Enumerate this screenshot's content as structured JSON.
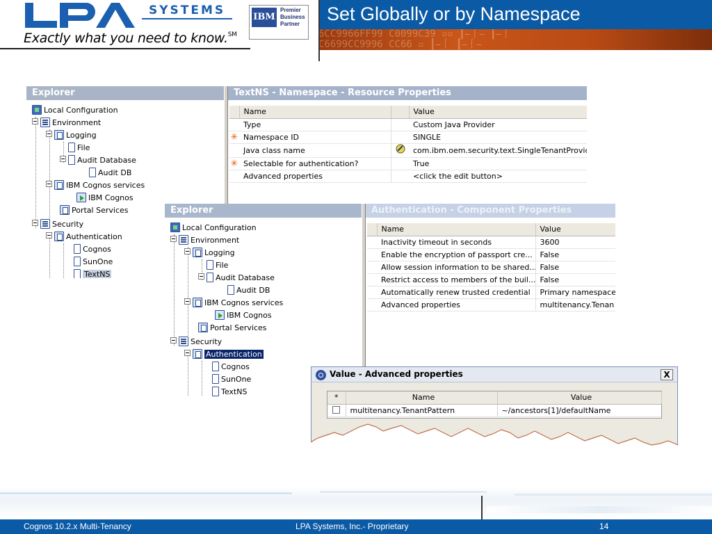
{
  "header": {
    "logo_text": "LPA",
    "logo_systems": "SYSTEMS",
    "tagline": "Exactly what you need to know.",
    "tagline_mark": "SM",
    "ibm_mark": "IBM",
    "ibm_badge_lines": [
      "Premier",
      "Business",
      "Partner"
    ],
    "slide_title": "Set Globally or by Namespace"
  },
  "explorer_common": {
    "pane_title": "Explorer",
    "tree": [
      "Local Configuration",
      "Environment",
      "Logging",
      "File",
      "Audit Database",
      "Audit DB",
      "IBM Cognos services",
      "IBM Cognos",
      "Portal Services",
      "Security",
      "Authentication",
      "Cognos",
      "SunOne",
      "TextNS"
    ]
  },
  "window1": {
    "props_title": "TextNS - Namespace - Resource Properties",
    "columns": [
      "Name",
      "Value"
    ],
    "rows": [
      {
        "required": false,
        "name": "Type",
        "value": "Custom Java Provider"
      },
      {
        "required": true,
        "name": "Namespace ID",
        "value": "SINGLE"
      },
      {
        "required": false,
        "name": "Java class name",
        "value": "com.ibm.oem.security.text.SingleTenantProvider"
      },
      {
        "required": true,
        "name": "Selectable for authentication?",
        "value": "True"
      },
      {
        "required": false,
        "name": "Advanced properties",
        "value": "<click the edit button>"
      }
    ],
    "selected_tree_item": "TextNS"
  },
  "window2": {
    "props_title": "Authentication - Component Properties",
    "columns": [
      "Name",
      "Value"
    ],
    "rows": [
      {
        "name": "Inactivity timeout in seconds",
        "value": "3600"
      },
      {
        "name": "Enable the encryption of passport cre...",
        "value": "False"
      },
      {
        "name": "Allow session information to be shared...",
        "value": "False"
      },
      {
        "name": "Restrict access to members of the buil...",
        "value": "False"
      },
      {
        "name": "Automatically renew trusted credential",
        "value": "Primary namespace"
      },
      {
        "name": "Advanced properties",
        "value": "multitenancy.Tenan"
      }
    ],
    "selected_tree_item": "Authentication"
  },
  "dialog": {
    "title": "Value - Advanced properties",
    "close_label": "X",
    "columns": [
      "*",
      "Name",
      "Value"
    ],
    "rows": [
      {
        "checked": false,
        "name": "multitenancy.TenantPattern",
        "value": "~/ancestors[1]/defaultName"
      }
    ]
  },
  "footer": {
    "left": "Cognos 10.2.x Multi-Tenancy",
    "center": "LPA Systems, Inc.- Proprietary",
    "page": "14"
  },
  "colors": {
    "title_band": "#0b5aa6",
    "deco_band": "#c9561a",
    "required_marker": "#e65a00",
    "selection": "#0a246a"
  }
}
